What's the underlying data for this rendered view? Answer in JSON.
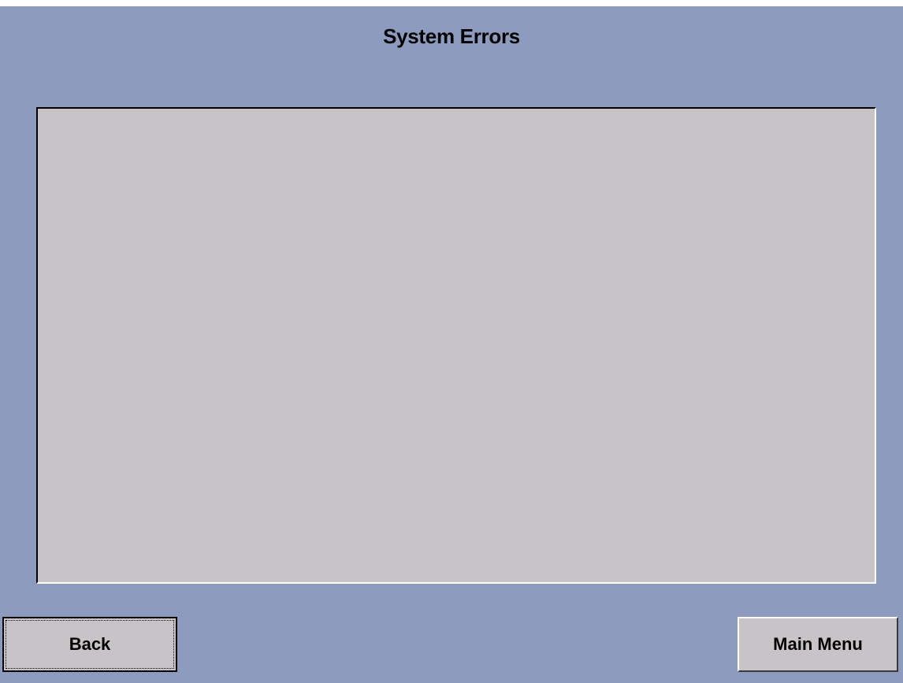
{
  "screen": {
    "title": "System Errors",
    "background_color": "#8d9bbf",
    "panel_color": "#c8c3c7"
  },
  "error_list": {
    "items": []
  },
  "buttons": {
    "back_label": "Back",
    "main_menu_label": "Main Menu"
  }
}
